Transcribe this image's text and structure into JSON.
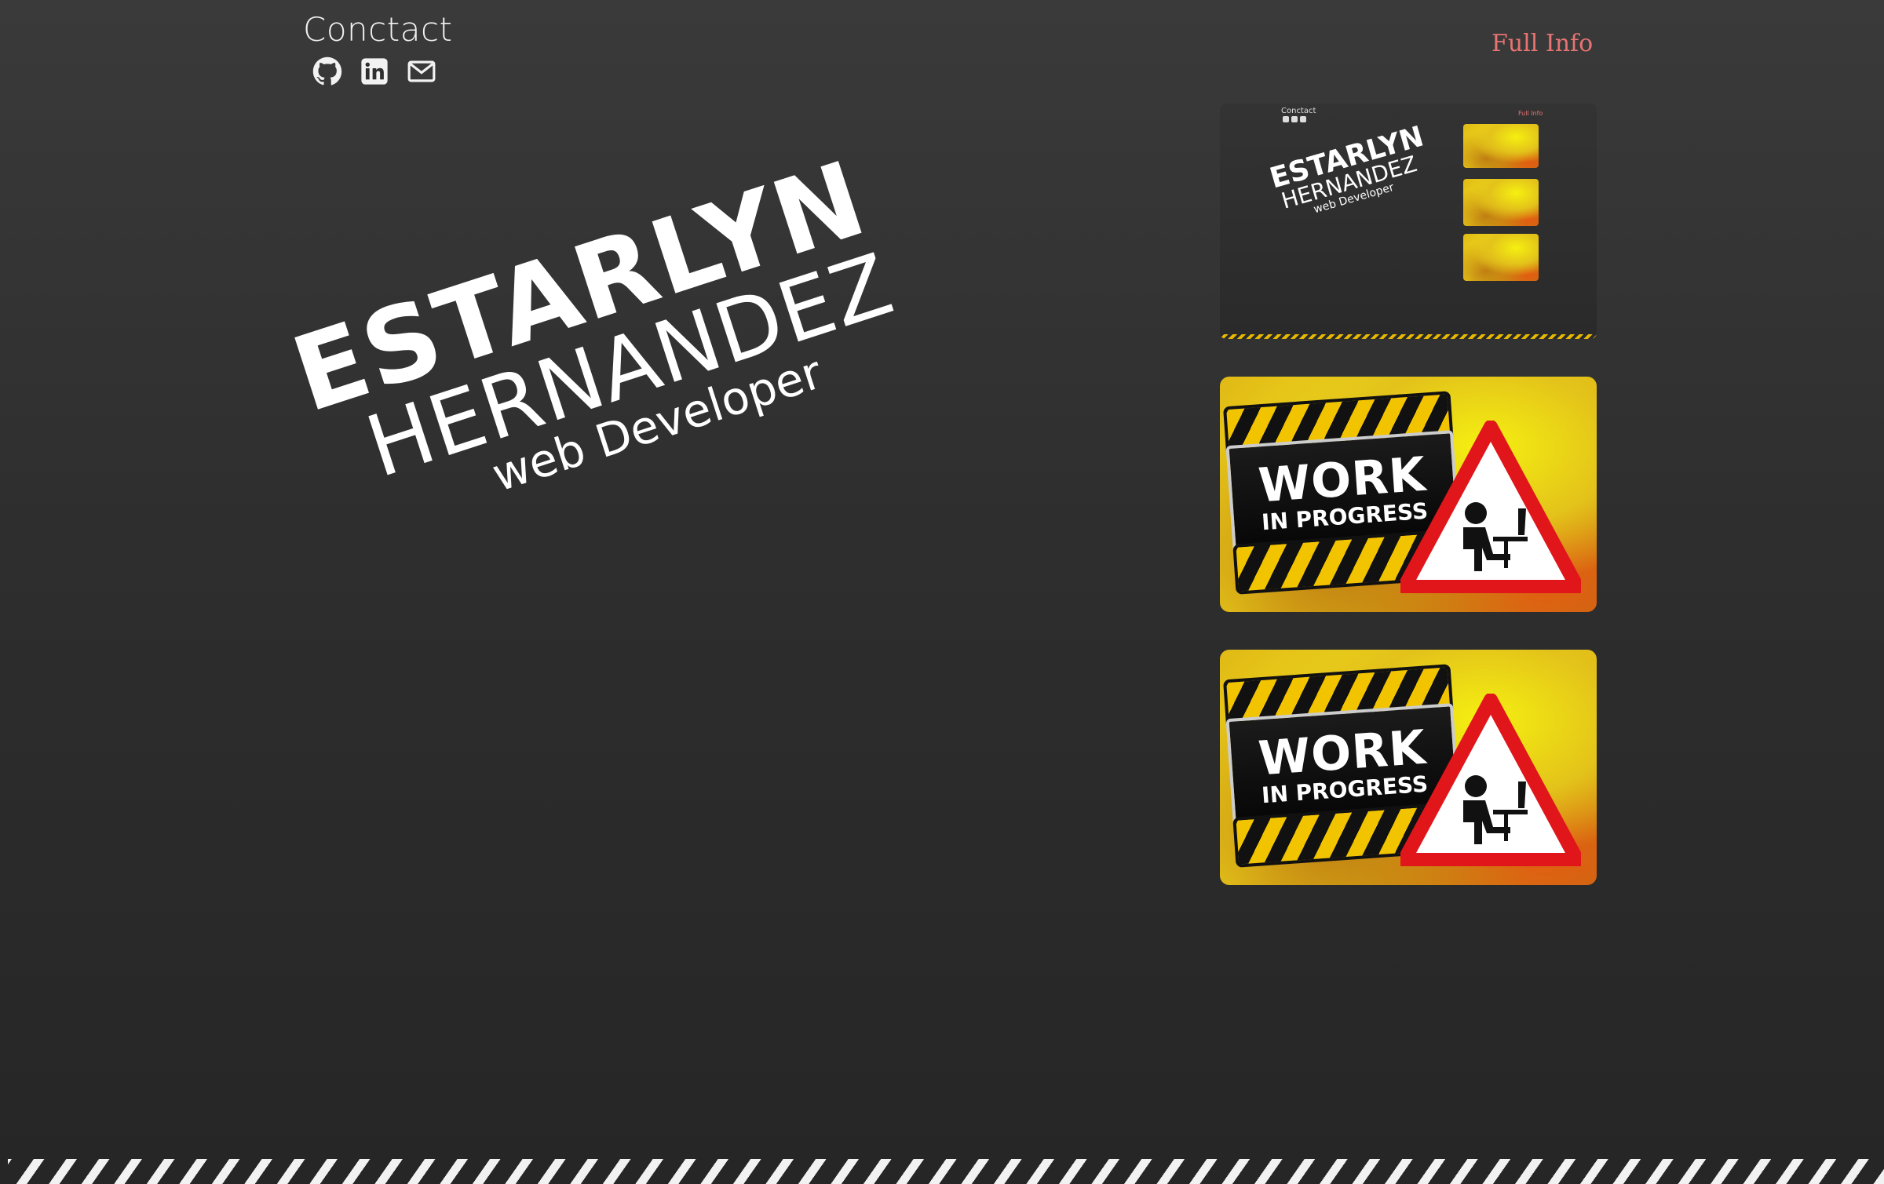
{
  "contact": {
    "title": "Conctact",
    "icons": [
      "github-icon",
      "linkedin-icon",
      "mail-icon"
    ]
  },
  "nav": {
    "full_info": "Full Info"
  },
  "hero": {
    "first_name": "ESTARLYN",
    "last_name": "HERNANDEZ",
    "role": "web Developer"
  },
  "projects": {
    "preview": {
      "contact": "Conctact",
      "full_info": "Full Info",
      "first_name": "ESTARLYN",
      "last_name": "HERNANDEZ",
      "role": "web Developer"
    },
    "wip_cards": [
      {
        "word": "WORK",
        "sub": "IN PROGRESS"
      },
      {
        "word": "WORK",
        "sub": "IN PROGRESS"
      }
    ]
  },
  "colors": {
    "background": "#2e2e2e",
    "accent": "#e77472",
    "text": "#ffffff"
  }
}
